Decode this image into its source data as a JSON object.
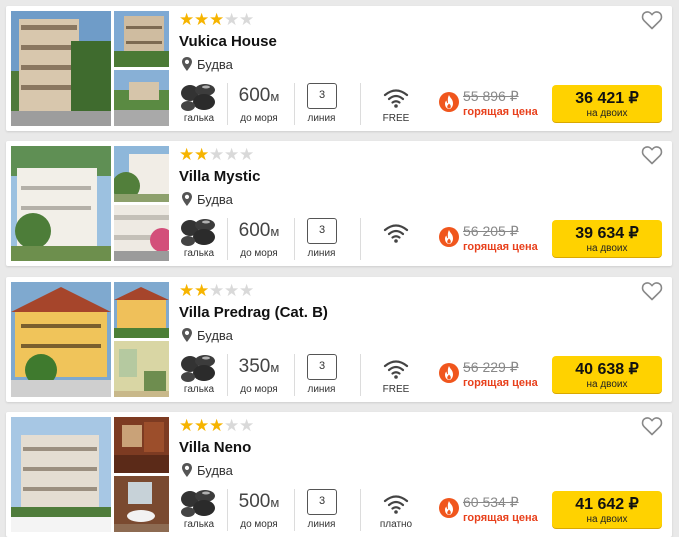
{
  "colors": {
    "accent_yellow": "#ffd200",
    "hot_red": "#e8401c",
    "star_gold": "#f6b400",
    "star_grey": "#d9d9d9"
  },
  "icons": {
    "star": "star-icon",
    "pin": "location-pin-icon",
    "pebbles": "pebbles-icon",
    "wifi": "wifi-icon",
    "fire": "fire-icon",
    "heart": "heart-icon"
  },
  "hotels": [
    {
      "name": "Vukica House",
      "stars": 3,
      "max_stars": 5,
      "location": "Будва",
      "beach_label": "галька",
      "distance_value": "600",
      "distance_unit": "м",
      "distance_label": "до моря",
      "line_number": "3",
      "line_label": "линия",
      "wifi_label": "FREE",
      "old_price": "55 896 ₽",
      "hot_label": "горящая цена",
      "price": "36 421 ₽",
      "price_sub": "на двоих"
    },
    {
      "name": "Villa Mystic",
      "stars": 2,
      "max_stars": 5,
      "location": "Будва",
      "beach_label": "галька",
      "distance_value": "600",
      "distance_unit": "м",
      "distance_label": "до моря",
      "line_number": "3",
      "line_label": "линия",
      "wifi_label": "",
      "old_price": "56 205 ₽",
      "hot_label": "горящая цена",
      "price": "39 634 ₽",
      "price_sub": "на двоих"
    },
    {
      "name": "Villa Predrag (Cat. B)",
      "stars": 2,
      "max_stars": 5,
      "location": "Будва",
      "beach_label": "галька",
      "distance_value": "350",
      "distance_unit": "м",
      "distance_label": "до моря",
      "line_number": "3",
      "line_label": "линия",
      "wifi_label": "FREE",
      "old_price": "56 229 ₽",
      "hot_label": "горящая цена",
      "price": "40 638 ₽",
      "price_sub": "на двоих"
    },
    {
      "name": "Villa Neno",
      "stars": 3,
      "max_stars": 5,
      "location": "Будва",
      "beach_label": "галька",
      "distance_value": "500",
      "distance_unit": "м",
      "distance_label": "до моря",
      "line_number": "3",
      "line_label": "линия",
      "wifi_label": "платно",
      "old_price": "60 534 ₽",
      "hot_label": "горящая цена",
      "price": "41 642 ₽",
      "price_sub": "на двоих"
    }
  ]
}
